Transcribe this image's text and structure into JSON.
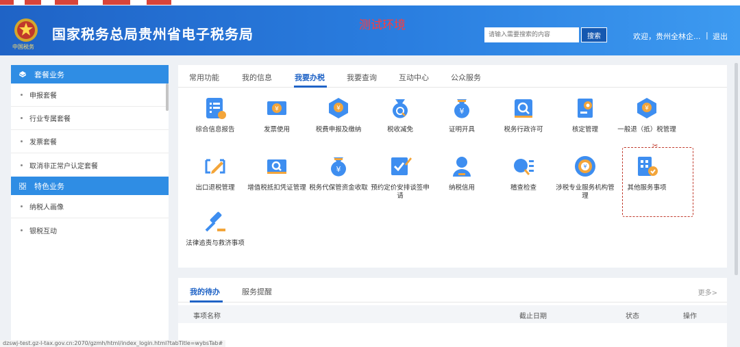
{
  "header": {
    "title": "国家税务总局贵州省电子税务局",
    "emblem_caption": "中国税务",
    "env_label": "测试环境",
    "search_placeholder": "请输入需要搜索的内容",
    "search_button": "搜索",
    "welcome": "欢迎，贵州全林企...",
    "separator": "|",
    "logout": "退出"
  },
  "sidebar": {
    "section1": "套餐业务",
    "items1": [
      "申报套餐",
      "行业专属套餐",
      "发票套餐",
      "取消非正常户认定套餐"
    ],
    "section2": "特色业务",
    "items2": [
      "纳税人画像",
      "银税互动"
    ]
  },
  "tabs": [
    "常用功能",
    "我的信息",
    "我要办税",
    "我要查询",
    "互动中心",
    "公众服务"
  ],
  "active_tab": "我要办税",
  "tiles": [
    {
      "label": "综合信息报告",
      "icon": "report-icon"
    },
    {
      "label": "发票使用",
      "icon": "invoice-icon"
    },
    {
      "label": "税费申报及缴纳",
      "icon": "tax-declare-icon"
    },
    {
      "label": "税收减免",
      "icon": "tax-reduction-icon"
    },
    {
      "label": "证明开具",
      "icon": "certificate-icon"
    },
    {
      "label": "税务行政许可",
      "icon": "admin-permit-icon"
    },
    {
      "label": "核定管理",
      "icon": "assessment-icon"
    },
    {
      "label": "一般退（抵）税管理",
      "icon": "refund-icon"
    },
    {
      "label": "出口退税管理",
      "icon": "export-refund-icon"
    },
    {
      "label": "增值税抵扣凭证管理",
      "icon": "vat-deduction-icon"
    },
    {
      "label": "税务代保管资金收取",
      "icon": "custody-fund-icon"
    },
    {
      "label": "预约定价安排谈签申请",
      "icon": "pricing-agreement-icon"
    },
    {
      "label": "纳税信用",
      "icon": "tax-credit-icon"
    },
    {
      "label": "稽查检查",
      "icon": "inspection-icon"
    },
    {
      "label": "涉税专业服务机构管理",
      "icon": "agency-icon"
    },
    {
      "label": "其他服务事项",
      "icon": "other-services-icon"
    },
    {
      "label": "法律追责与救济事项",
      "icon": "legal-icon"
    }
  ],
  "bottom": {
    "tabs": [
      "我的待办",
      "服务提醒"
    ],
    "more": "更多>",
    "columns": [
      "事项名称",
      "截止日期",
      "状态",
      "操作"
    ]
  },
  "status_url": "dzswj-test.gz-l-tax.gov.cn:2070/gzmh/html/index_login.html?tabTitle=wybsTab#",
  "colors": {
    "brand": "#1f63c6",
    "accent": "#2f8de4",
    "env": "#ff3b3b",
    "highlight": "#c0392b"
  }
}
